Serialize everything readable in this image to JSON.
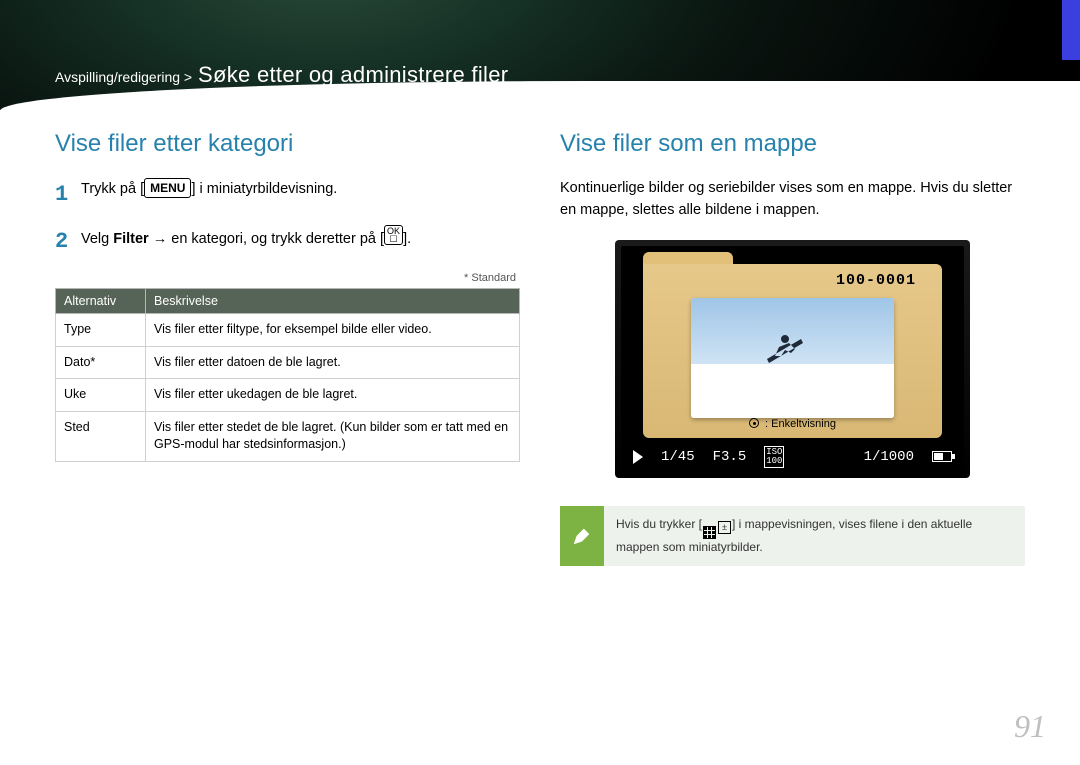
{
  "breadcrumb": {
    "section": "Avspilling/redigering >",
    "title": "Søke etter og administrere filer"
  },
  "left": {
    "heading": "Vise filer etter kategori",
    "step1_num": "1",
    "step1_pre": "Trykk på [",
    "step1_menu": "MENU",
    "step1_post": "] i miniatyrbildevisning.",
    "step2_num": "2",
    "step2_pre": "Velg ",
    "step2_bold": "Filter",
    "step2_mid": " → en kategori, og trykk deretter på [",
    "step2_ok_top": "OK",
    "step2_ok_bot": "☐",
    "step2_post": "].",
    "standard": "* Standard",
    "th1": "Alternativ",
    "th2": "Beskrivelse",
    "rows": [
      {
        "opt": "Type",
        "desc": "Vis filer etter filtype, for eksempel bilde eller video."
      },
      {
        "opt": "Dato*",
        "desc": "Vis filer etter datoen de ble lagret."
      },
      {
        "opt": "Uke",
        "desc": "Vis filer etter ukedagen de ble lagret."
      },
      {
        "opt": "Sted",
        "desc": "Vis filer etter stedet de ble lagret. (Kun bilder som er tatt med en GPS-modul har stedsinformasjon.)"
      }
    ]
  },
  "right": {
    "heading": "Vise filer som en mappe",
    "body": "Kontinuerlige bilder og seriebilder vises som en mappe. Hvis du sletter en mappe, slettes alle bildene i mappen.",
    "folder_label": "100-0001",
    "caption": " : Enkeltvisning",
    "status": {
      "count": "1/45",
      "f": "F3.5",
      "iso_top": "ISO",
      "iso_bot": "100",
      "shutter": "1/1000"
    },
    "tip_pre": "Hvis du trykker [",
    "tip_post": "] i mappevisningen, vises filene i den aktuelle mappen som miniatyrbilder."
  },
  "page": "91"
}
